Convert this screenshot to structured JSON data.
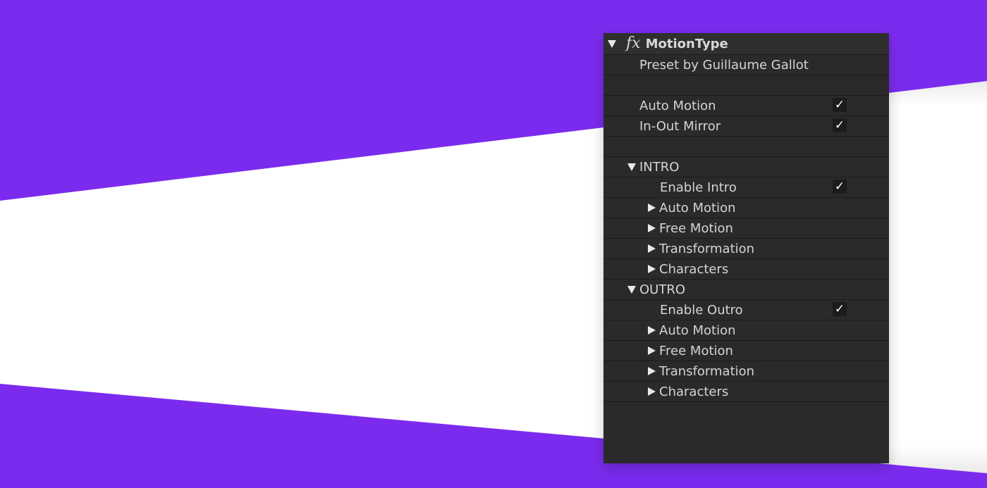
{
  "effect": {
    "name": "MotionType",
    "fx_label": "fx",
    "preset": "Preset by Guillaume Gallot"
  },
  "options": [
    {
      "label": "Auto Motion",
      "checked": true,
      "check_glyph": "✓"
    },
    {
      "label": "In-Out Mirror",
      "checked": true,
      "check_glyph": "✓"
    }
  ],
  "intro": {
    "label": "INTRO",
    "enable": {
      "label": "Enable Intro",
      "check_glyph": "✓"
    },
    "groups": [
      "Auto Motion",
      "Free Motion",
      "Transformation",
      "Characters"
    ]
  },
  "outro": {
    "label": "OUTRO",
    "enable": {
      "label": "Enable Outro",
      "check_glyph": "✓"
    },
    "groups": [
      "Auto Motion",
      "Free Motion",
      "Transformation",
      "Characters"
    ]
  },
  "colors": {
    "background_purple": "#7b2bee",
    "band_white": "#ffffff",
    "panel_bg": "#2a2a2a",
    "text": "#d4d4d4"
  },
  "icons": {
    "twirl_open": "triangle-down-icon",
    "twirl_closed": "triangle-right-icon",
    "effect": "fx-icon",
    "checkbox": "checkmark-icon"
  }
}
